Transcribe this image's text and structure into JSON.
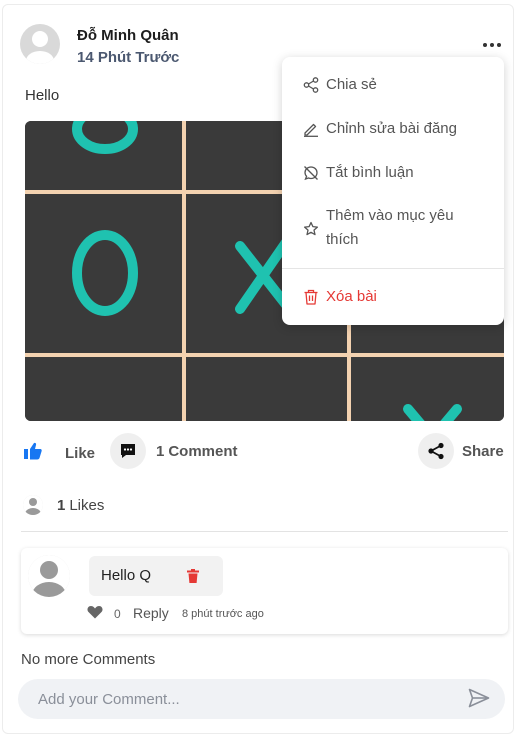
{
  "post": {
    "author": "Đỗ Minh Quân",
    "time": "14 Phút Trước",
    "text": "Hello"
  },
  "actions": {
    "like": "Like",
    "comment_count": "1",
    "comment_label": "Comment",
    "share": "Share"
  },
  "likes": {
    "count": "1",
    "label": "Likes"
  },
  "comment": {
    "text": "Hello Q",
    "like_count": "0",
    "reply": "Reply",
    "time": "8 phút trước ago"
  },
  "footer": {
    "no_more": "No more Comments",
    "input_placeholder": "Add your Comment..."
  },
  "menu": {
    "share": "Chia sẻ",
    "edit": "Chỉnh sửa bài đăng",
    "disable_comments": "Tắt bình luận",
    "favorite_line1": "Thêm vào mục yêu",
    "favorite_line2": "thích",
    "delete": "Xóa bài"
  },
  "colors": {
    "accent_blue": "#1877f2",
    "danger": "#e53935",
    "tile_teal": "#1fc2b0",
    "grid_line": "#f3d2b0"
  },
  "icons": {
    "more": "ellipsis-horizontal-icon",
    "like": "thumbs-up-icon",
    "comment": "comment-icon",
    "share": "share-icon",
    "send": "send-icon"
  }
}
